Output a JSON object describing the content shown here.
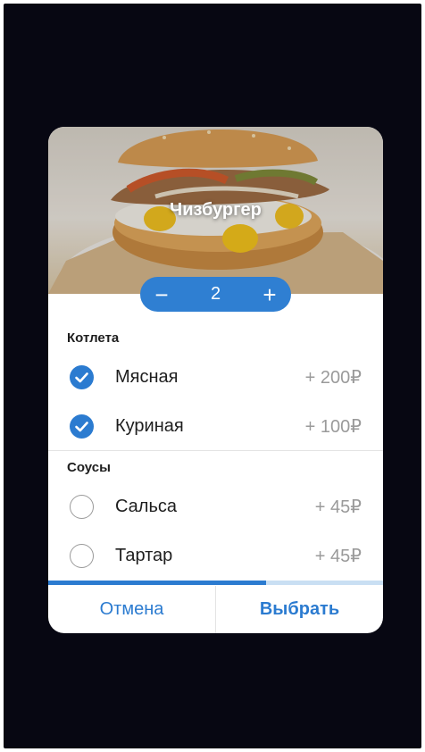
{
  "product": {
    "title": "Чизбургер",
    "quantity": "2",
    "decrement_symbol": "−",
    "increment_symbol": "+"
  },
  "sections": [
    {
      "title": "Котлета",
      "options": [
        {
          "label": "Мясная",
          "price": "+ 200₽",
          "checked": true
        },
        {
          "label": "Куриная",
          "price": "+ 100₽",
          "checked": true
        }
      ]
    },
    {
      "title": "Соусы",
      "options": [
        {
          "label": "Сальса",
          "price": "+ 45₽",
          "checked": false
        },
        {
          "label": "Тартар",
          "price": "+ 45₽",
          "checked": false
        }
      ]
    }
  ],
  "progress": 0.65,
  "footer": {
    "cancel_label": "Отмена",
    "select_label": "Выбрать"
  },
  "colors": {
    "accent": "#2b7bd0",
    "backdrop": "#070712",
    "price": "#9a9a9a"
  },
  "icons": {
    "checked": "checkmark-circle-icon",
    "unchecked": "empty-circle-icon"
  }
}
